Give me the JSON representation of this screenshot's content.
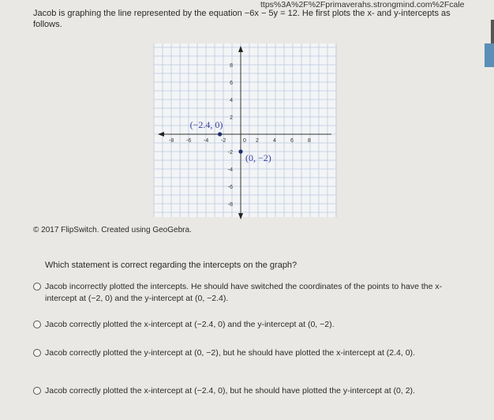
{
  "browser": {
    "url_fragment": "ttps%3A%2F%2Fprimaverahs.strongmind.com%2Fcale"
  },
  "question": {
    "text": "Jacob is graphing the line represented by the equation −6x − 5y = 12. He first plots the x- and y-intercepts as follows.",
    "credit": "© 2017 FlipSwitch. Created using GeoGebra.",
    "prompt": "Which statement is correct regarding the intercepts on the graph?"
  },
  "graph": {
    "x_ticks": [
      -8,
      -6,
      -4,
      -2,
      0,
      2,
      4,
      6,
      8
    ],
    "y_ticks": [
      8,
      6,
      4,
      2,
      -2,
      -4,
      -6,
      -8
    ],
    "points": [
      {
        "x": -2.4,
        "y": 0,
        "label": "(−2.4, 0)"
      },
      {
        "x": 0,
        "y": -2,
        "label": "(0, −2)"
      }
    ],
    "point_color": "#1f2f6e",
    "label_color": "#3b3f9a"
  },
  "options": [
    {
      "text": "Jacob incorrectly plotted the intercepts. He should have switched the coordinates of the points to have the x-intercept at (−2, 0) and the y-intercept at (0, −2.4)."
    },
    {
      "text": "Jacob correctly plotted the x-intercept at (−2.4, 0) and the y-intercept at (0, −2)."
    },
    {
      "text": "Jacob correctly plotted the y-intercept at (0, −2), but he should have plotted the x-intercept at (2.4, 0)."
    },
    {
      "text": "Jacob correctly plotted the x-intercept at (−2.4, 0), but he should have plotted the y-intercept at (0, 2)."
    }
  ]
}
